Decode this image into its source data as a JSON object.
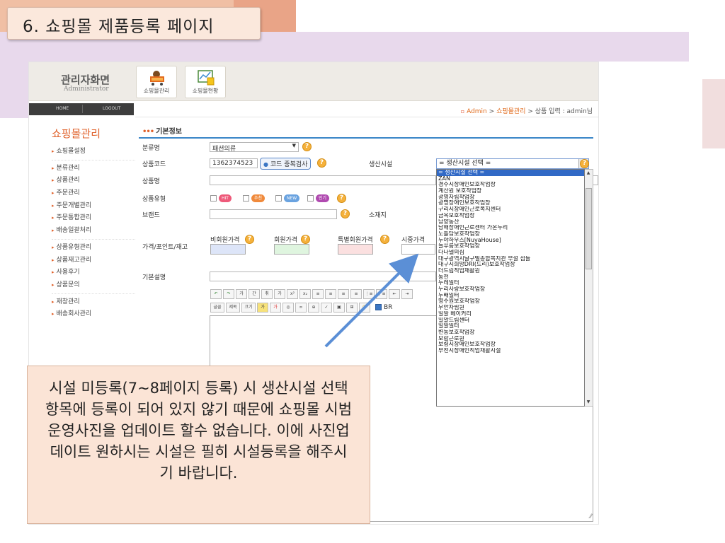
{
  "slide": {
    "title": "6. 쇼핑몰 제품등록 페이지",
    "note": "시설 미등록(7~8페이지 등록) 시 생산시설 선택항목에 등록이 되어 있지 않기 때문에 쇼핑몰 시범운영사진을 업데이트 할수 없습니다. 이에 사진업데이트 원하시는 시설은 필히 시설등록을 해주시기 바랍니다."
  },
  "admin": {
    "logo_title": "관리자화면",
    "logo_sub": "Administrator",
    "top_buttons": [
      {
        "label": "쇼핑몰관리",
        "icon": "shopping-cart-icon"
      },
      {
        "label": "쇼핑몰현황",
        "icon": "chart-icon"
      }
    ],
    "nav": {
      "home": "HOME",
      "logout": "LOGOUT"
    },
    "breadcrumb": {
      "root": "Admin",
      "sep1": ">",
      "mid": "쇼핑몰관리",
      "sep2": ">",
      "current": "상품 입력",
      "user": ": admin님"
    },
    "sidebar": {
      "title": "쇼핑몰관리",
      "group1": [
        "쇼핑몰설정"
      ],
      "group2": [
        "분류관리",
        "상품관리",
        "주문관리",
        "주문개별관리",
        "주문통합관리",
        "배송일괄처리"
      ],
      "group3": [
        "상품유형관리",
        "상품재고관리",
        "사용후기",
        "상품문의"
      ],
      "group4": [
        "재창관리",
        "배송회사관리"
      ]
    },
    "section_title": "기본정보",
    "form": {
      "category_label": "분류명",
      "category_value": "패션의류",
      "code_label": "상품코드",
      "code_value": "1362374523",
      "code_check_btn": "코드 중복검사",
      "facility_label": "생산시설",
      "facility_selected": "= 생산시설 선택 =",
      "name_label": "상품명",
      "type_label": "상품유형",
      "type_badges": [
        {
          "text": "HIT",
          "color": "#ee5a7a"
        },
        {
          "text": "추천",
          "color": "#f08a3c"
        },
        {
          "text": "NEW",
          "color": "#6aa3e0"
        },
        {
          "text": "인기",
          "color": "#b04ab0"
        }
      ],
      "brand_label": "브랜드",
      "origin_label": "소재지",
      "price_group_label": "가격/포인트/재고",
      "price_labels": [
        "비회원가격",
        "회원가격",
        "특별회원가격",
        "시중가격"
      ],
      "desc_label": "기본설명",
      "editor_row1": [
        "↶",
        "↷",
        "가",
        "간",
        "취",
        "가",
        "x²",
        "x₂",
        "≡",
        "≡",
        "≡",
        "≡",
        "⋮≡",
        "⋮≡",
        "⇤",
        "⇥"
      ],
      "editor_row2": [
        "글꼴",
        "제목",
        "크기",
        "가",
        "가",
        "◎",
        "∞",
        "⊕",
        "✓",
        "▣",
        "⊞",
        "☺"
      ],
      "br_label": "BR"
    },
    "dropdown_options": [
      "= 생산시설 선택 =",
      "ZAN",
      "경주시장애인보호작업장",
      "계산원 보호작업장",
      "광명자립작업장",
      "광명장애인보호작업장",
      "구리시장애인근로복지센터",
      "금옥보호작업장",
      "남양동산",
      "남해장애인근로센터 가온누리",
      "노틀담보호작업장",
      "누야하우스[NuyaHouse]",
      "늘푸름보호작업장",
      "다나델의집",
      "대구광역시달구벌종합복지관 부설 섬들",
      "대구시희망DRI(드리)보호작업장",
      "더드림직업재활원",
      "동천",
      "두레일터",
      "두리사랑보호작업장",
      "두배일터",
      "명주원보호작업장",
      "무안자립원",
      "밀알 베이커리",
      "밀알드림센터",
      "밀알일터",
      "변동보호작업장",
      "보람근로원",
      "보령시장애인보호작업장",
      "부천시장애인직업재활시설"
    ]
  }
}
